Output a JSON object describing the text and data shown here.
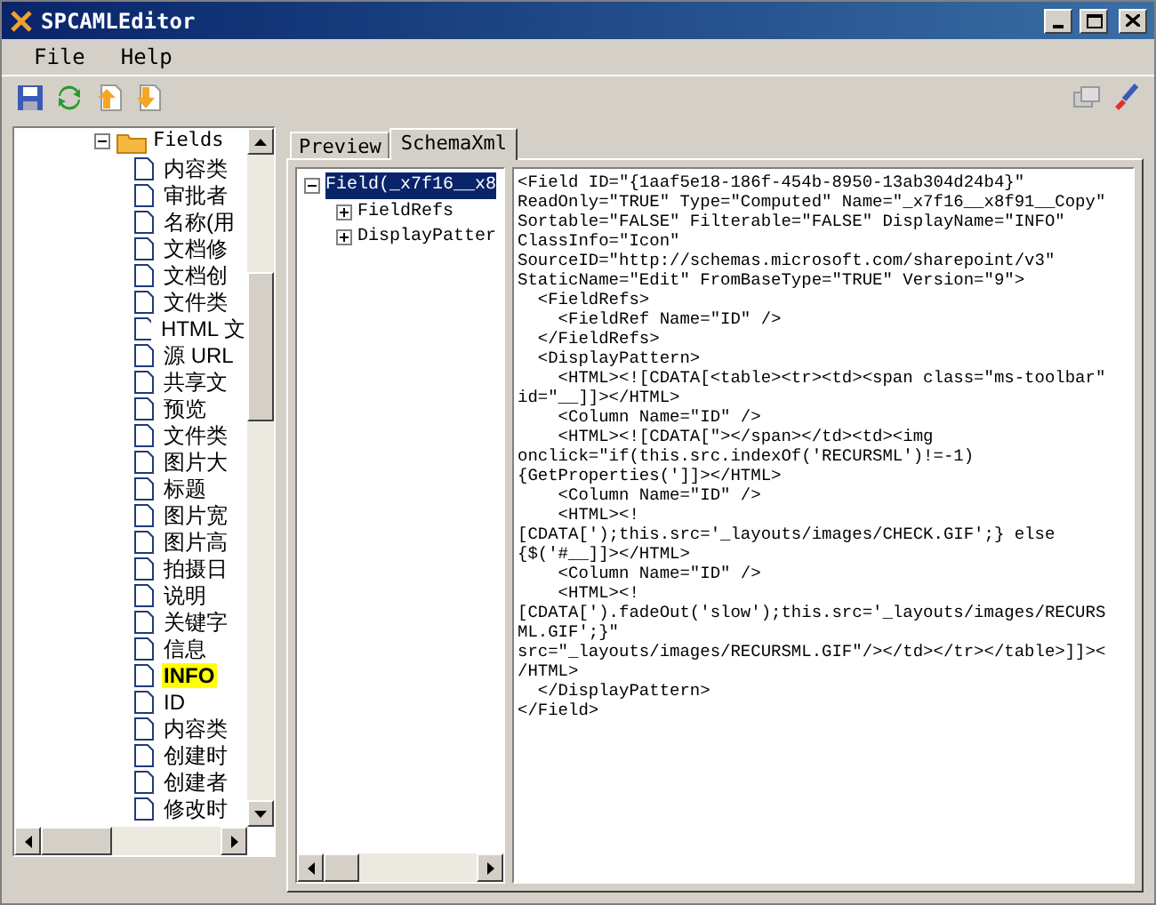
{
  "window": {
    "title": "SPCAMLEditor"
  },
  "menu": [
    "File",
    "Help"
  ],
  "fields_tree": {
    "label": "Fields",
    "expanded": true,
    "children": [
      {
        "label": "内容类",
        "selected": false
      },
      {
        "label": "审批者",
        "selected": false
      },
      {
        "label": "名称(用",
        "selected": false
      },
      {
        "label": "文档修",
        "selected": false
      },
      {
        "label": "文档创",
        "selected": false
      },
      {
        "label": "文件类",
        "selected": false
      },
      {
        "label": "HTML 文",
        "selected": false
      },
      {
        "label": "源 URL",
        "selected": false
      },
      {
        "label": "共享文",
        "selected": false
      },
      {
        "label": "预览",
        "selected": false
      },
      {
        "label": "文件类",
        "selected": false
      },
      {
        "label": "图片大",
        "selected": false
      },
      {
        "label": "标题",
        "selected": false
      },
      {
        "label": "图片宽",
        "selected": false
      },
      {
        "label": "图片高",
        "selected": false
      },
      {
        "label": "拍摄日",
        "selected": false
      },
      {
        "label": "说明",
        "selected": false
      },
      {
        "label": "关键字",
        "selected": false
      },
      {
        "label": "信息",
        "selected": false
      },
      {
        "label": "INFO",
        "selected": true
      },
      {
        "label": "ID",
        "selected": false
      },
      {
        "label": "内容类",
        "selected": false
      },
      {
        "label": "创建时",
        "selected": false
      },
      {
        "label": "创建者",
        "selected": false
      },
      {
        "label": "修改时",
        "selected": false
      }
    ]
  },
  "tabs": [
    {
      "label": "Preview",
      "selected": false
    },
    {
      "label": "SchemaXml",
      "selected": true
    }
  ],
  "schema_tree": {
    "label": "Field(_x7f16__x8",
    "selected": true,
    "expanded": true,
    "children": [
      {
        "label": "FieldRefs",
        "expanded": false
      },
      {
        "label": "DisplayPatter",
        "expanded": false
      }
    ]
  },
  "xml_lines": [
    "<Field ID=\"{1aaf5e18-186f-454b-8950-13ab304d24b4}\"",
    "ReadOnly=\"TRUE\" Type=\"Computed\" Name=\"_x7f16__x8f91__Copy\"",
    "Sortable=\"FALSE\" Filterable=\"FALSE\" DisplayName=\"INFO\"",
    "ClassInfo=\"Icon\"",
    "SourceID=\"http://schemas.microsoft.com/sharepoint/v3\"",
    "StaticName=\"Edit\" FromBaseType=\"TRUE\" Version=\"9\">",
    "  <FieldRefs>",
    "    <FieldRef Name=\"ID\" />",
    "  </FieldRefs>",
    "  <DisplayPattern>",
    "    <HTML><![CDATA[<table><tr><td><span class=\"ms-toolbar\"",
    "id=\"__]]></HTML>",
    "    <Column Name=\"ID\" />",
    "    <HTML><![CDATA[\"></span></td><td><img",
    "onclick=\"if(this.src.indexOf('RECURSML')!=-1)",
    "{GetProperties(']]></HTML>",
    "    <Column Name=\"ID\" />",
    "    <HTML><!",
    "[CDATA[');this.src='_layouts/images/CHECK.GIF';} else",
    "{$('#__]]></HTML>",
    "    <Column Name=\"ID\" />",
    "    <HTML><!",
    "[CDATA[').fadeOut('slow');this.src='_layouts/images/RECURS",
    "ML.GIF';}\"",
    "src=\"_layouts/images/RECURSML.GIF\"/></td></tr></table>]]><",
    "/HTML>",
    "  </DisplayPattern>",
    "</Field>"
  ]
}
